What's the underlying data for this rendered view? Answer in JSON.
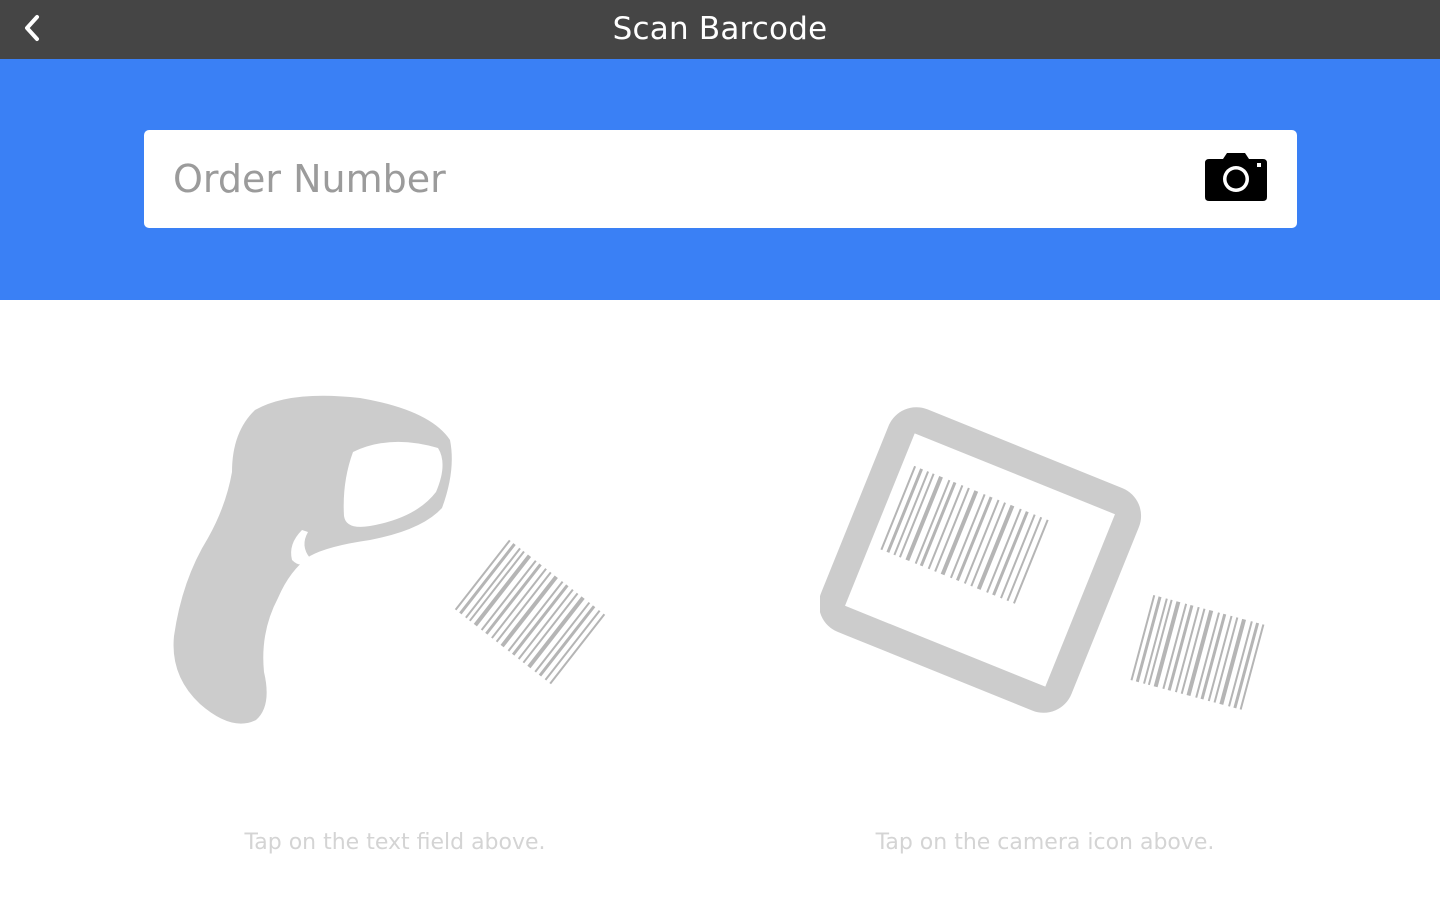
{
  "header": {
    "title": "Scan Barcode",
    "back_icon": "chevron-left-icon"
  },
  "search": {
    "placeholder": "Order Number",
    "value": "",
    "camera_icon": "camera-icon"
  },
  "instructions": {
    "left": {
      "illustration": "handheld-barcode-scanner",
      "text": "Tap on the text field above."
    },
    "right": {
      "illustration": "tablet-camera-scan",
      "text": "Tap on the camera icon above."
    }
  },
  "colors": {
    "topbar": "#454545",
    "band": "#3a80f5",
    "illustration": "#cccccc",
    "hint_text": "#d4d4d4"
  }
}
